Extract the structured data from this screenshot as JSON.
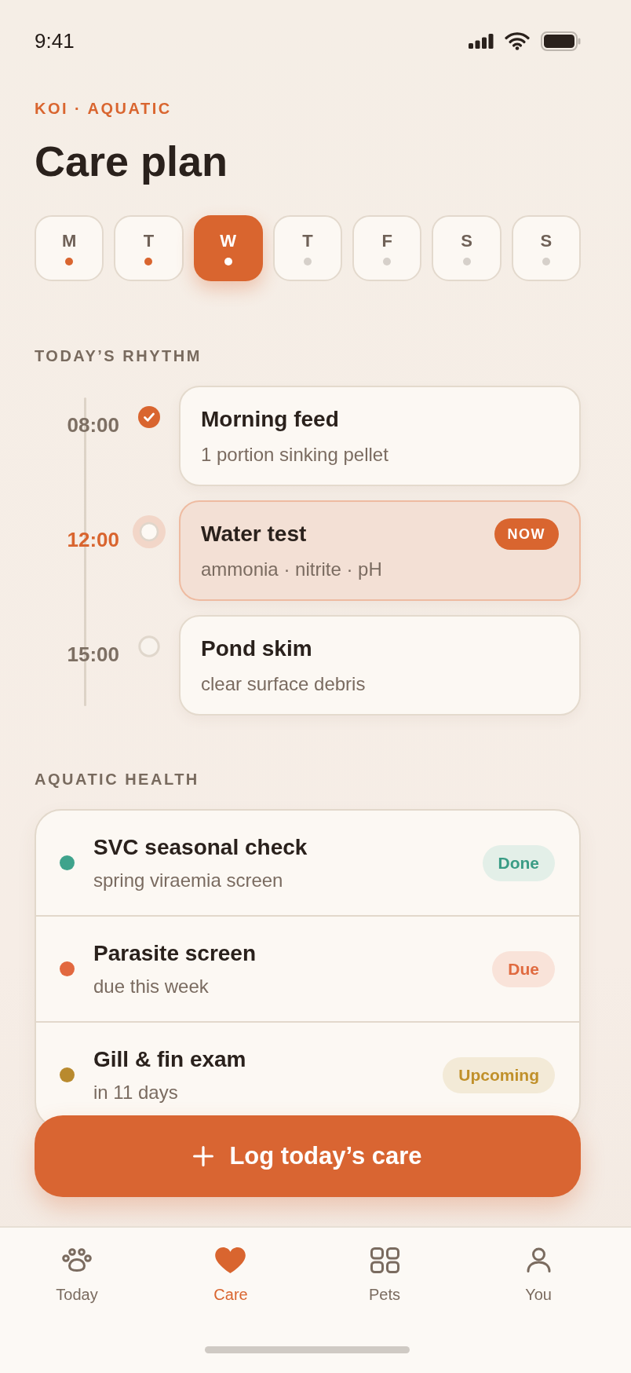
{
  "status_bar": {
    "time": "9:41"
  },
  "header": {
    "eyebrow": "KOI · AQUATIC",
    "title": "Care plan"
  },
  "days": [
    {
      "label": "M",
      "selected": false,
      "done": true
    },
    {
      "label": "T",
      "selected": false,
      "done": true
    },
    {
      "label": "W",
      "selected": true,
      "done": true
    },
    {
      "label": "T",
      "selected": false,
      "done": false
    },
    {
      "label": "F",
      "selected": false,
      "done": false
    },
    {
      "label": "S",
      "selected": false,
      "done": false
    },
    {
      "label": "S",
      "selected": false,
      "done": false
    }
  ],
  "rhythm": {
    "label": "TODAY’S RHYTHM",
    "items": [
      {
        "time": "08:00",
        "title": "Morning feed",
        "subtitle": "1 portion sinking pellet",
        "done": true,
        "current": false
      },
      {
        "time": "12:00",
        "title": "Water test",
        "subtitle": "ammonia · nitrite · pH",
        "done": false,
        "current": true,
        "badge": "NOW"
      },
      {
        "time": "15:00",
        "title": "Pond skim",
        "subtitle": "clear surface debris",
        "done": false,
        "current": false
      }
    ]
  },
  "health": {
    "label": "AQUATIC HEALTH",
    "items": [
      {
        "title": "SVC seasonal check",
        "subtitle": "spring viraemia screen",
        "color": "#3fa38c",
        "kind": "done",
        "badge": "Done"
      },
      {
        "title": "Parasite screen",
        "subtitle": "due this week",
        "color": "#e2683f",
        "kind": "due",
        "badge": "Due"
      },
      {
        "title": "Gill & fin exam",
        "subtitle": "in 11 days",
        "color": "#b98a2e",
        "kind": "upcoming",
        "badge": "Upcoming"
      }
    ]
  },
  "action_button": {
    "label": "Log today’s care"
  },
  "tab_bar": {
    "items": [
      {
        "label": "Today",
        "selected": false
      },
      {
        "label": "Care",
        "selected": true
      },
      {
        "label": "Pets",
        "selected": false
      },
      {
        "label": "You",
        "selected": false
      }
    ]
  }
}
